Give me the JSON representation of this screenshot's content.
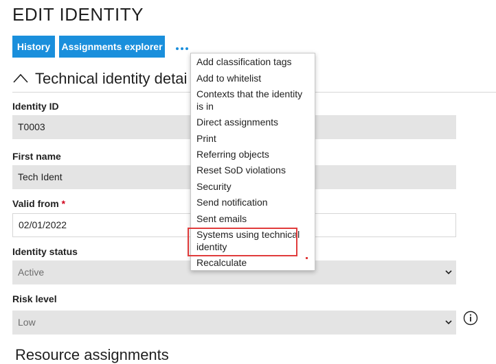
{
  "page": {
    "title": "EDIT IDENTITY"
  },
  "toolbar": {
    "history_label": "History",
    "assignments_label": "Assignments explorer",
    "more_icon": "ellipsis-icon"
  },
  "section": {
    "title": "Technical identity details",
    "visible_title": "Technical identity detai"
  },
  "fields": {
    "identity_id": {
      "label": "Identity ID",
      "value": "T0003"
    },
    "first_name": {
      "label": "First name",
      "value": "Tech Ident"
    },
    "valid_from": {
      "label": "Valid from",
      "required_mark": "*",
      "value": "02/01/2022"
    },
    "identity_status": {
      "label": "Identity status",
      "value": "Active"
    },
    "risk_level": {
      "label": "Risk level",
      "value": "Low"
    }
  },
  "next_section": {
    "title": "Resource assignments"
  },
  "menu": {
    "items": [
      "Add classification tags",
      "Add to whitelist",
      "Contexts that the identity is in",
      "Direct assignments",
      "Print",
      "Referring objects",
      "Reset SoD violations",
      "Security",
      "Send notification",
      "Sent emails",
      "Systems using technical identity",
      "Recalculate"
    ],
    "highlighted_item": "Systems using technical identity"
  },
  "colors": {
    "accent": "#1a8fdc",
    "highlight": "#e03a3a",
    "field_bg": "#e4e4e4"
  }
}
